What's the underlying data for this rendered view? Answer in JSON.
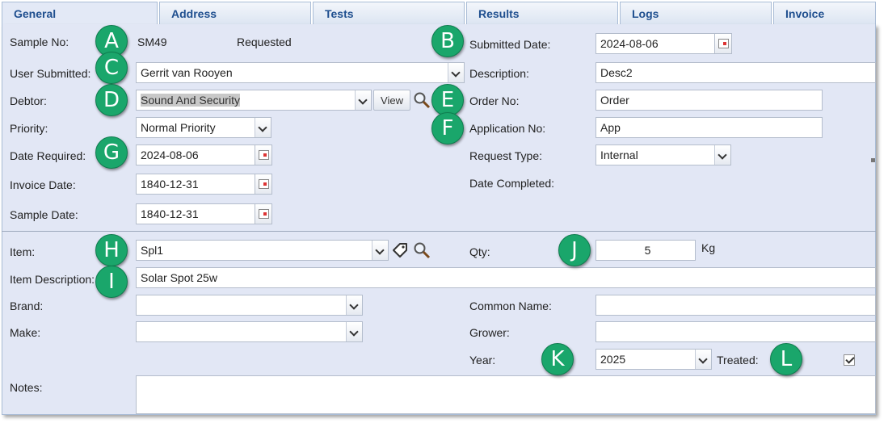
{
  "tabs": [
    "General",
    "Address",
    "Tests",
    "Results",
    "Logs",
    "Invoice"
  ],
  "markers": [
    "A",
    "B",
    "C",
    "D",
    "E",
    "F",
    "G",
    "H",
    "I",
    "J",
    "K",
    "L"
  ],
  "sample": {
    "no_label": "Sample No:",
    "no_value": "SM49",
    "status": "Requested",
    "user_label": "User Submitted:",
    "user_value": "Gerrit van Rooyen",
    "debtor_label": "Debtor:",
    "debtor_value": "Sound And Security",
    "view_label": "View",
    "priority_label": "Priority:",
    "priority_value": "Normal Priority",
    "date_required_label": "Date Required:",
    "date_required_value": "2024-08-06",
    "invoice_date_label": "Invoice Date:",
    "invoice_date_value": "1840-12-31",
    "sample_date_label": "Sample Date:",
    "sample_date_value": "1840-12-31",
    "submitted_date_label": "Submitted Date:",
    "submitted_date_value": "2024-08-06",
    "description_label": "Description:",
    "description_value": "Desc2",
    "order_no_label": "Order No:",
    "order_no_value": "Order",
    "application_no_label": "Application No:",
    "application_no_value": "App",
    "request_type_label": "Request Type:",
    "request_type_value": "Internal",
    "date_completed_label": "Date Completed:"
  },
  "item": {
    "item_label": "Item:",
    "item_value": "Spl1",
    "qty_label": "Qty:",
    "qty_value": "5",
    "qty_unit": "Kg",
    "desc_label": "Item Description:",
    "desc_value": "Solar Spot 25w",
    "brand_label": "Brand:",
    "brand_value": "",
    "make_label": "Make:",
    "make_value": "",
    "common_name_label": "Common Name:",
    "common_name_value": "",
    "grower_label": "Grower:",
    "grower_value": "",
    "year_label": "Year:",
    "year_value": "2025",
    "treated_label": "Treated:",
    "treated_checked": true,
    "notes_label": "Notes:",
    "notes_value": ""
  },
  "colors": {
    "panel": "#e2e7f5",
    "tab_text": "#1f4f8f",
    "marker": "#1aa66b"
  }
}
